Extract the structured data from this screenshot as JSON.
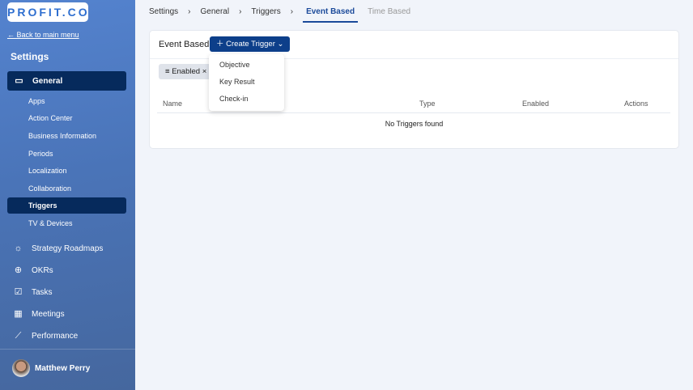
{
  "sidebar": {
    "logo": "PROFIT.CO",
    "back": "← Back to main menu",
    "heading": "Settings",
    "general": "General",
    "sub_items": [
      "Apps",
      "Action Center",
      "Business Information",
      "Periods",
      "Localization",
      "Collaboration",
      "Triggers",
      "TV & Devices"
    ],
    "nav": [
      {
        "label": "Strategy Roadmaps",
        "icon": "bulb-icon"
      },
      {
        "label": "OKRs",
        "icon": "target-icon"
      },
      {
        "label": "Tasks",
        "icon": "clipboard-check-icon"
      },
      {
        "label": "Meetings",
        "icon": "calendar-icon"
      },
      {
        "label": "Performance",
        "icon": "chart-line-icon"
      }
    ],
    "user": "Matthew Perry"
  },
  "breadcrumb": {
    "items": [
      "Settings",
      "General",
      "Triggers"
    ],
    "tabs": [
      "Event Based",
      "Time Based"
    ]
  },
  "card": {
    "title": "Event Based",
    "create": "Create Trigger",
    "filter": "Enabled",
    "columns": [
      "Name",
      "Type",
      "Enabled",
      "Actions"
    ],
    "empty": "No Triggers found"
  },
  "dropdown": [
    "Objective",
    "Key Result",
    "Check-in"
  ]
}
